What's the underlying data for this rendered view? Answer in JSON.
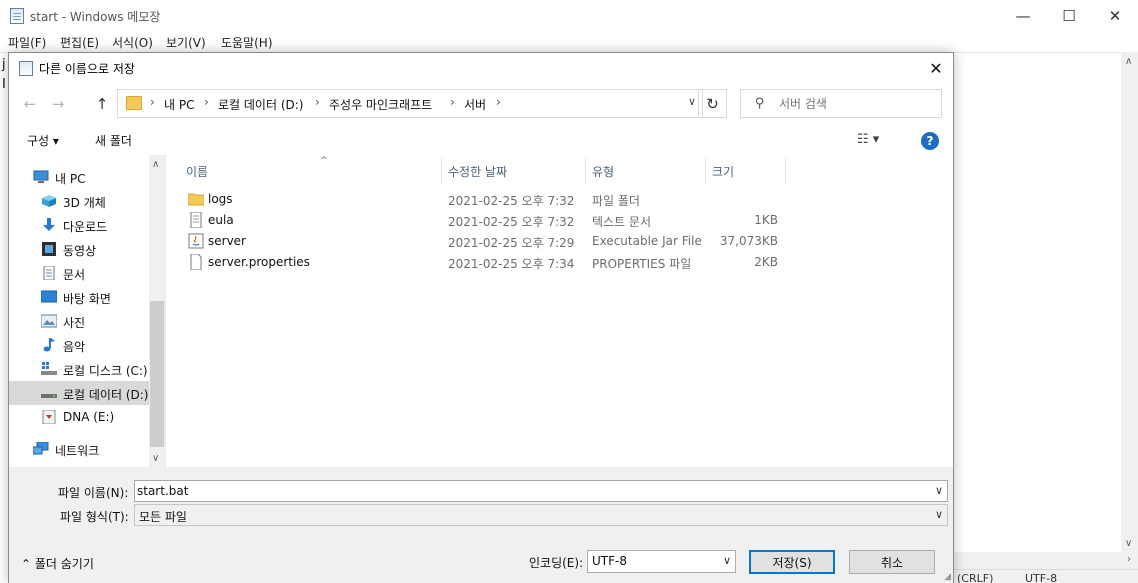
{
  "notepad": {
    "title": "start - Windows 메모장",
    "menu": [
      "파일(F)",
      "편집(E)",
      "서식(O)",
      "보기(V)",
      "도움말(H)"
    ],
    "edit_chars": [
      "j",
      "I"
    ],
    "status": {
      "line_ending": "(CRLF)",
      "encoding": "UTF-8"
    },
    "win_buttons": {
      "minimize": "—",
      "maximize": "☐",
      "close": "✕"
    }
  },
  "dialog": {
    "title": "다른 이름으로 저장",
    "close_glyph": "✕",
    "nav": {
      "back": "←",
      "forward": "→",
      "up": "↑"
    },
    "breadcrumbs": [
      "내 PC",
      "로컬 데이터 (D:)",
      "주성우 마인크래프트",
      "서버"
    ],
    "crumb_sep": "›",
    "addr_drop": "∨",
    "refresh": "↻",
    "search": {
      "placeholder": "서버 검색",
      "icon_glyph": "⚲"
    },
    "toolbar": {
      "organize": "구성 ▾",
      "new_folder": "새 폴더",
      "view_glyph": "☷ ▾",
      "help_glyph": "?"
    },
    "nav_pane": [
      {
        "label": "내 PC",
        "icon": "pc-icon"
      },
      {
        "label": "3D 개체",
        "icon": "3d-objects-icon"
      },
      {
        "label": "다운로드",
        "icon": "download-icon"
      },
      {
        "label": "동영상",
        "icon": "video-icon"
      },
      {
        "label": "문서",
        "icon": "document-icon"
      },
      {
        "label": "바탕 화면",
        "icon": "desktop-icon"
      },
      {
        "label": "사진",
        "icon": "picture-icon"
      },
      {
        "label": "음악",
        "icon": "music-icon"
      },
      {
        "label": "로컬 디스크 (C:)",
        "icon": "drive-c-icon"
      },
      {
        "label": "로컬 데이터 (D:)",
        "icon": "drive-d-icon"
      },
      {
        "label": "DNA (E:)",
        "icon": "drive-e-icon"
      },
      {
        "label": "네트워크",
        "icon": "network-icon"
      }
    ],
    "nav_scroll": {
      "up": "∧",
      "down": "∨"
    },
    "columns": {
      "name": "이름",
      "date": "수정한 날짜",
      "type": "유형",
      "size": "크기",
      "sort_glyph": "^"
    },
    "files": [
      {
        "name": "logs",
        "date": "2021-02-25 오후 7:32",
        "type": "파일 폴더",
        "size": "",
        "icon": "folder-icon"
      },
      {
        "name": "eula",
        "date": "2021-02-25 오후 7:32",
        "type": "텍스트 문서",
        "size": "1KB",
        "icon": "text-file-icon"
      },
      {
        "name": "server",
        "date": "2021-02-25 오후 7:29",
        "type": "Executable Jar File",
        "size": "37,073KB",
        "icon": "jar-file-icon"
      },
      {
        "name": "server.properties",
        "date": "2021-02-25 오후 7:34",
        "type": "PROPERTIES 파일",
        "size": "2KB",
        "icon": "file-icon"
      }
    ],
    "form": {
      "filename_label": "파일 이름(N):",
      "filename_value": "start.bat",
      "filetype_label": "파일 형식(T):",
      "filetype_value": "모든 파일",
      "drop_glyph": "∨"
    },
    "footer": {
      "hide_folders": "⌃ 폴더 숨기기",
      "encoding_label": "인코딩(E):",
      "encoding_value": "UTF-8",
      "save": "저장(S)",
      "cancel": "취소"
    }
  }
}
